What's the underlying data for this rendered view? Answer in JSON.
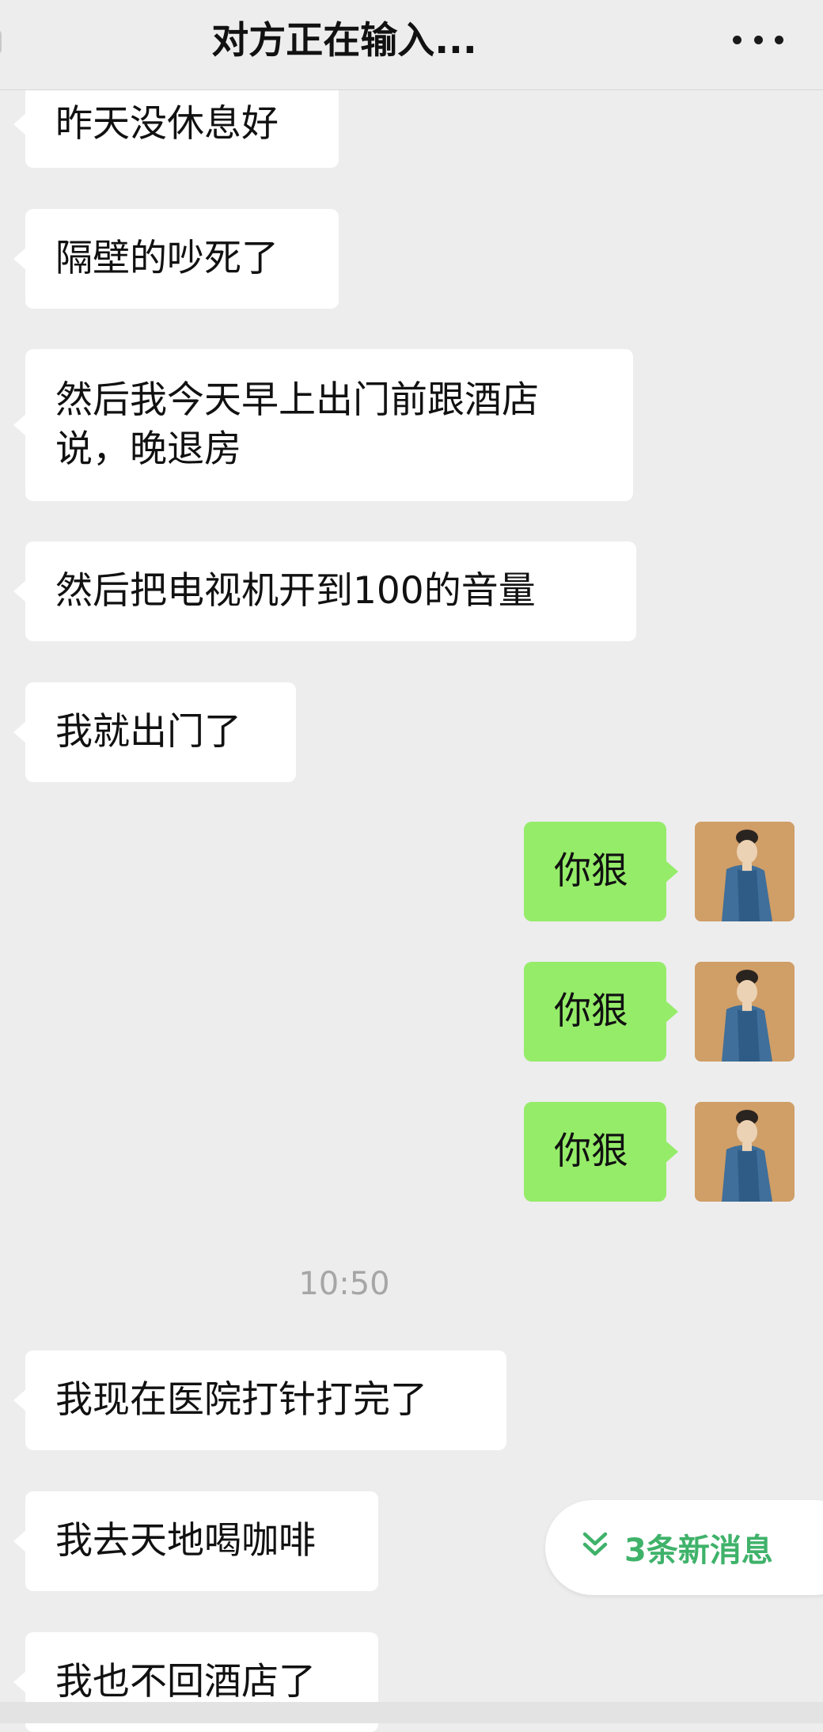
{
  "header": {
    "title": "对方正在输入...",
    "more_icon": "more-dots-icon"
  },
  "messages": [
    {
      "side": "left",
      "text": "昨天没休息好"
    },
    {
      "side": "left",
      "text": "隔壁的吵死了"
    },
    {
      "side": "left",
      "text": "然后我今天早上出门前跟酒店说，晚退房"
    },
    {
      "side": "left",
      "text": "然后把电视机开到100的音量"
    },
    {
      "side": "left",
      "text": "我就出门了"
    },
    {
      "side": "right",
      "text": "你狠"
    },
    {
      "side": "right",
      "text": "你狠"
    },
    {
      "side": "right",
      "text": "你狠"
    },
    {
      "side": "left",
      "text": "我现在医院打针打完了"
    },
    {
      "side": "left",
      "text": "我去天地喝咖啡"
    },
    {
      "side": "left",
      "text": "我也不回酒店了"
    }
  ],
  "timestamp": "10:50",
  "new_messages_button": {
    "label": "3条新消息",
    "icon": "double-chevron-down-icon"
  },
  "colors": {
    "background": "#ededed",
    "left_bubble": "#ffffff",
    "right_bubble": "#95ec69",
    "accent_green": "#3fb26a"
  }
}
